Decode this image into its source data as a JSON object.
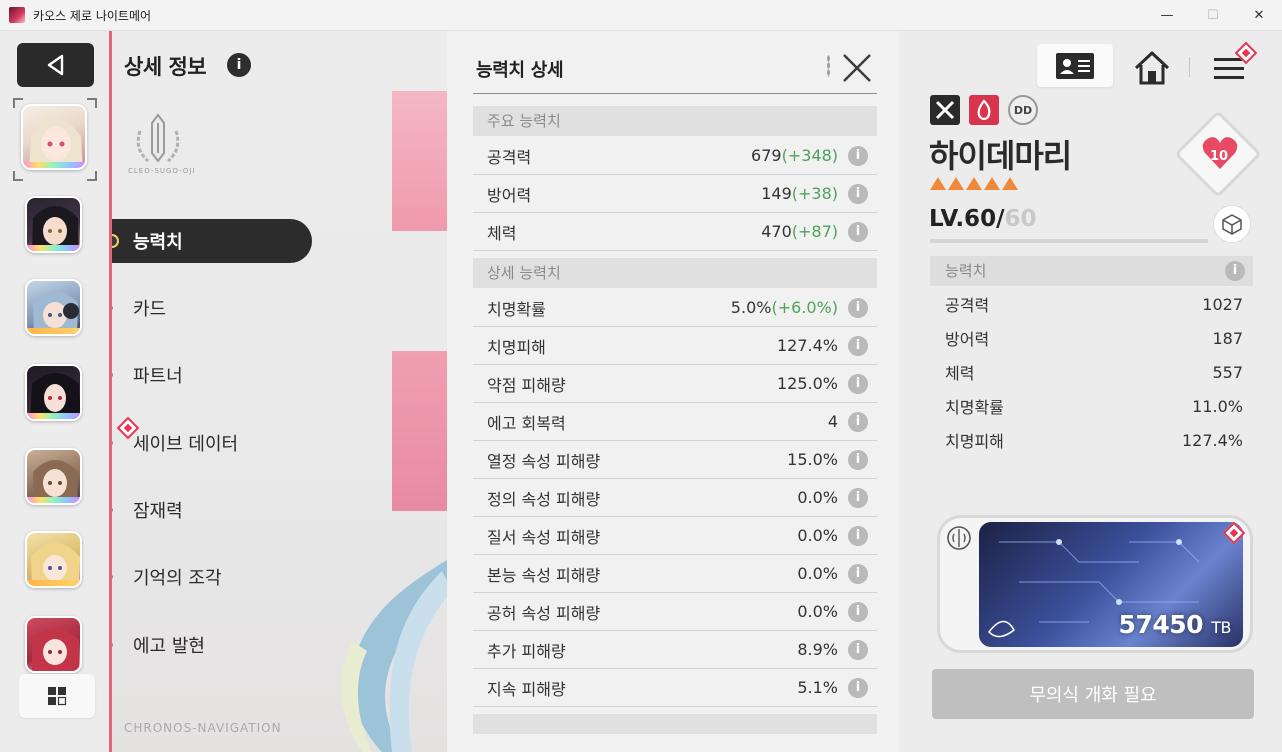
{
  "window": {
    "title": "카오스 제로 나이트메어",
    "minimize_glyph": "—",
    "maximize_glyph": "☐",
    "close_glyph": "✕"
  },
  "colors": {
    "accent_pink": "#e46478",
    "bonus_green": "#4da35b",
    "alert_red": "#e8344f",
    "rarity_orange": "#f0883a"
  },
  "nav": {
    "title": "상세 정보",
    "info_glyph": "i",
    "crest_text": "CLEO-SUGO-OJI",
    "footer_text": "CHRONOS-NAVIGATION",
    "items": [
      {
        "label": "능력치",
        "active": true
      },
      {
        "label": "카드"
      },
      {
        "label": "파트너"
      },
      {
        "label": "세이브 데이터",
        "alert": true
      },
      {
        "label": "잠재력"
      },
      {
        "label": "기억의 조각"
      },
      {
        "label": "에고 발현"
      }
    ]
  },
  "detail": {
    "title": "능력치 상세",
    "info_glyph": "i",
    "primary_section": "주요 능력치",
    "primary": [
      {
        "label": "공격력",
        "value": "679",
        "bonus": "(+348)"
      },
      {
        "label": "방어력",
        "value": "149",
        "bonus": "(+38)"
      },
      {
        "label": "체력",
        "value": "470",
        "bonus": "(+87)"
      }
    ],
    "detail_section": "상세 능력치",
    "details": [
      {
        "label": "치명확률",
        "value": "5.0%",
        "bonus": "(+6.0%)"
      },
      {
        "label": "치명피해",
        "value": "127.4%",
        "bonus": ""
      },
      {
        "label": "약점 피해량",
        "value": "125.0%",
        "bonus": ""
      },
      {
        "label": "에고 회복력",
        "value": "4",
        "bonus": ""
      },
      {
        "label": "열정 속성 피해량",
        "value": "15.0%",
        "bonus": ""
      },
      {
        "label": "정의 속성 피해량",
        "value": "0.0%",
        "bonus": ""
      },
      {
        "label": "질서 속성 피해량",
        "value": "0.0%",
        "bonus": ""
      },
      {
        "label": "본능 속성 피해량",
        "value": "0.0%",
        "bonus": ""
      },
      {
        "label": "공허 속성 피해량",
        "value": "0.0%",
        "bonus": ""
      },
      {
        "label": "추가 피해량",
        "value": "8.9%",
        "bonus": ""
      },
      {
        "label": "지속 피해량",
        "value": "5.1%",
        "bonus": ""
      }
    ]
  },
  "character": {
    "name": "하이데마리",
    "rarity_stars": 5,
    "level_current": "LV.60/",
    "level_max": "60",
    "level_progress": 1.0,
    "affinity": "10",
    "stats_header": "능력치",
    "stats": [
      {
        "label": "공격력",
        "value": "1027"
      },
      {
        "label": "방어력",
        "value": "187"
      },
      {
        "label": "체력",
        "value": "557"
      },
      {
        "label": "치명확률",
        "value": "11.0%"
      },
      {
        "label": "치명피해",
        "value": "127.4%"
      }
    ],
    "card_value": "57450",
    "card_unit": "TB",
    "action_button": "무의식 개화 필요",
    "badge_icons": [
      "striker-class-icon",
      "passion-element-icon",
      "rank-badge-icon"
    ],
    "badge_rank_text": "DD"
  }
}
